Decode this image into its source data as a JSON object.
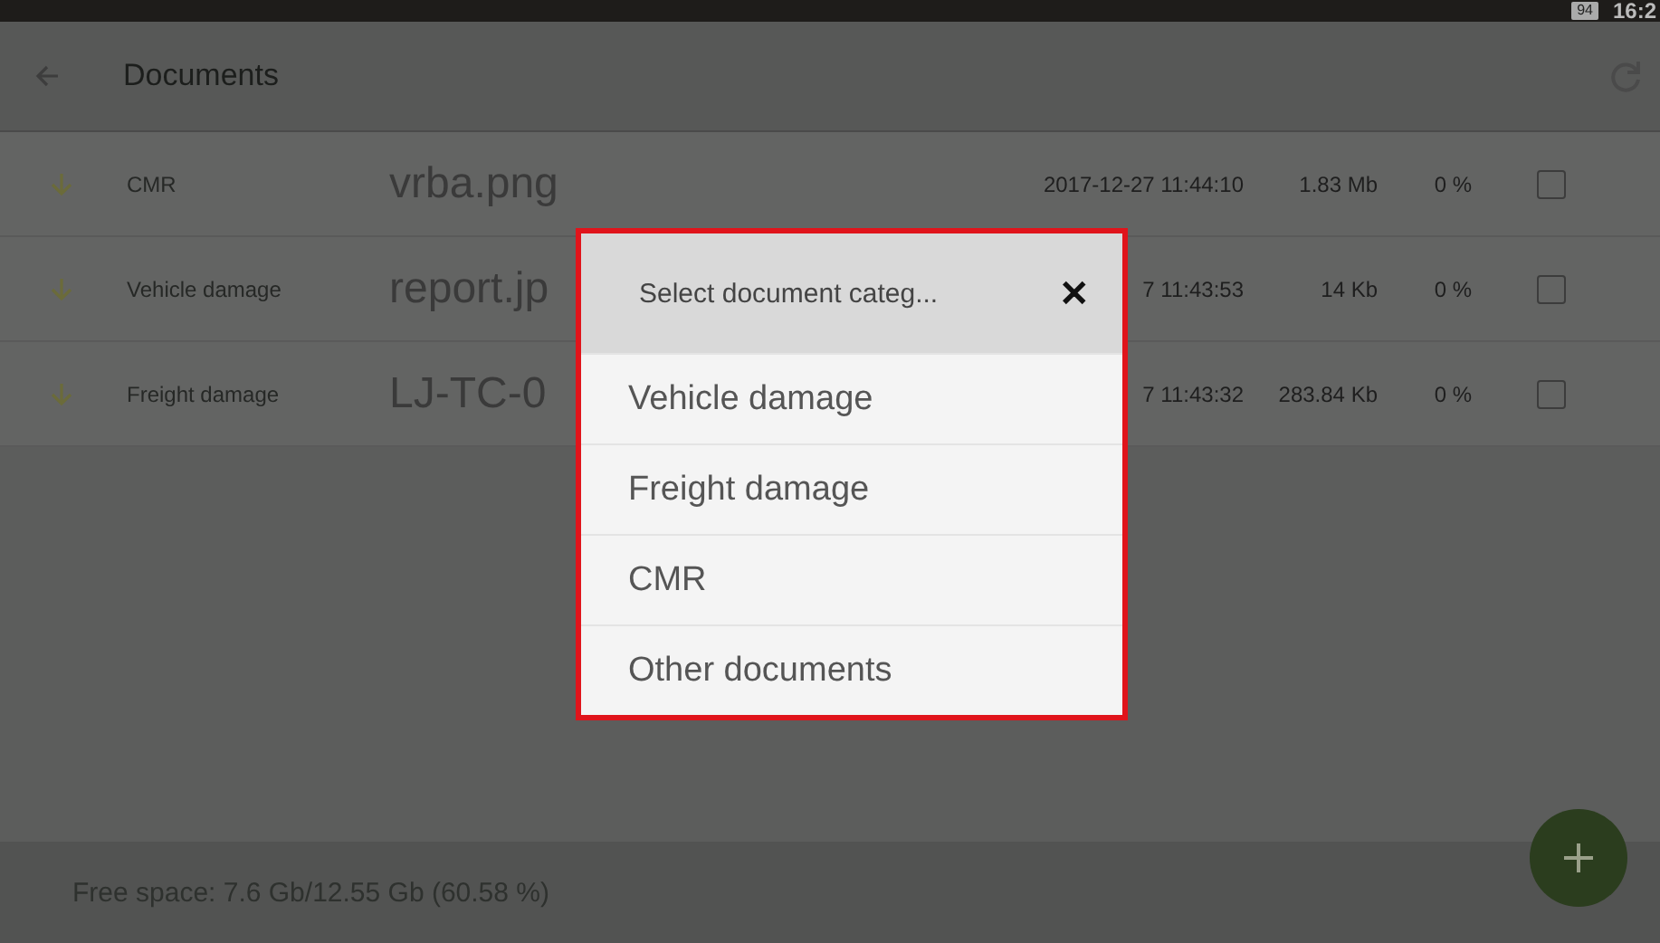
{
  "status_bar": {
    "battery": "94",
    "time": "16:2"
  },
  "app_bar": {
    "title": "Documents"
  },
  "documents": [
    {
      "category": "CMR",
      "file_name": "vrba.png",
      "date": "2017-12-27 11:44:10",
      "size": "1.83 Mb",
      "progress": "0 %",
      "checked": false
    },
    {
      "category": "Vehicle damage",
      "file_name": "report.jp",
      "date": "7 11:43:53",
      "size": "14 Kb",
      "progress": "0 %",
      "checked": false
    },
    {
      "category": "Freight damage",
      "file_name": "LJ-TC-0",
      "date": "7 11:43:32",
      "size": "283.84 Kb",
      "progress": "0 %",
      "checked": false
    }
  ],
  "dialog": {
    "title": "Select document categ...",
    "close": "✕",
    "options": [
      "Vehicle damage",
      "Freight damage",
      "CMR",
      "Other documents"
    ]
  },
  "footer": {
    "free_space": "Free space: 7.6 Gb/12.55 Gb (60.58 %)"
  }
}
